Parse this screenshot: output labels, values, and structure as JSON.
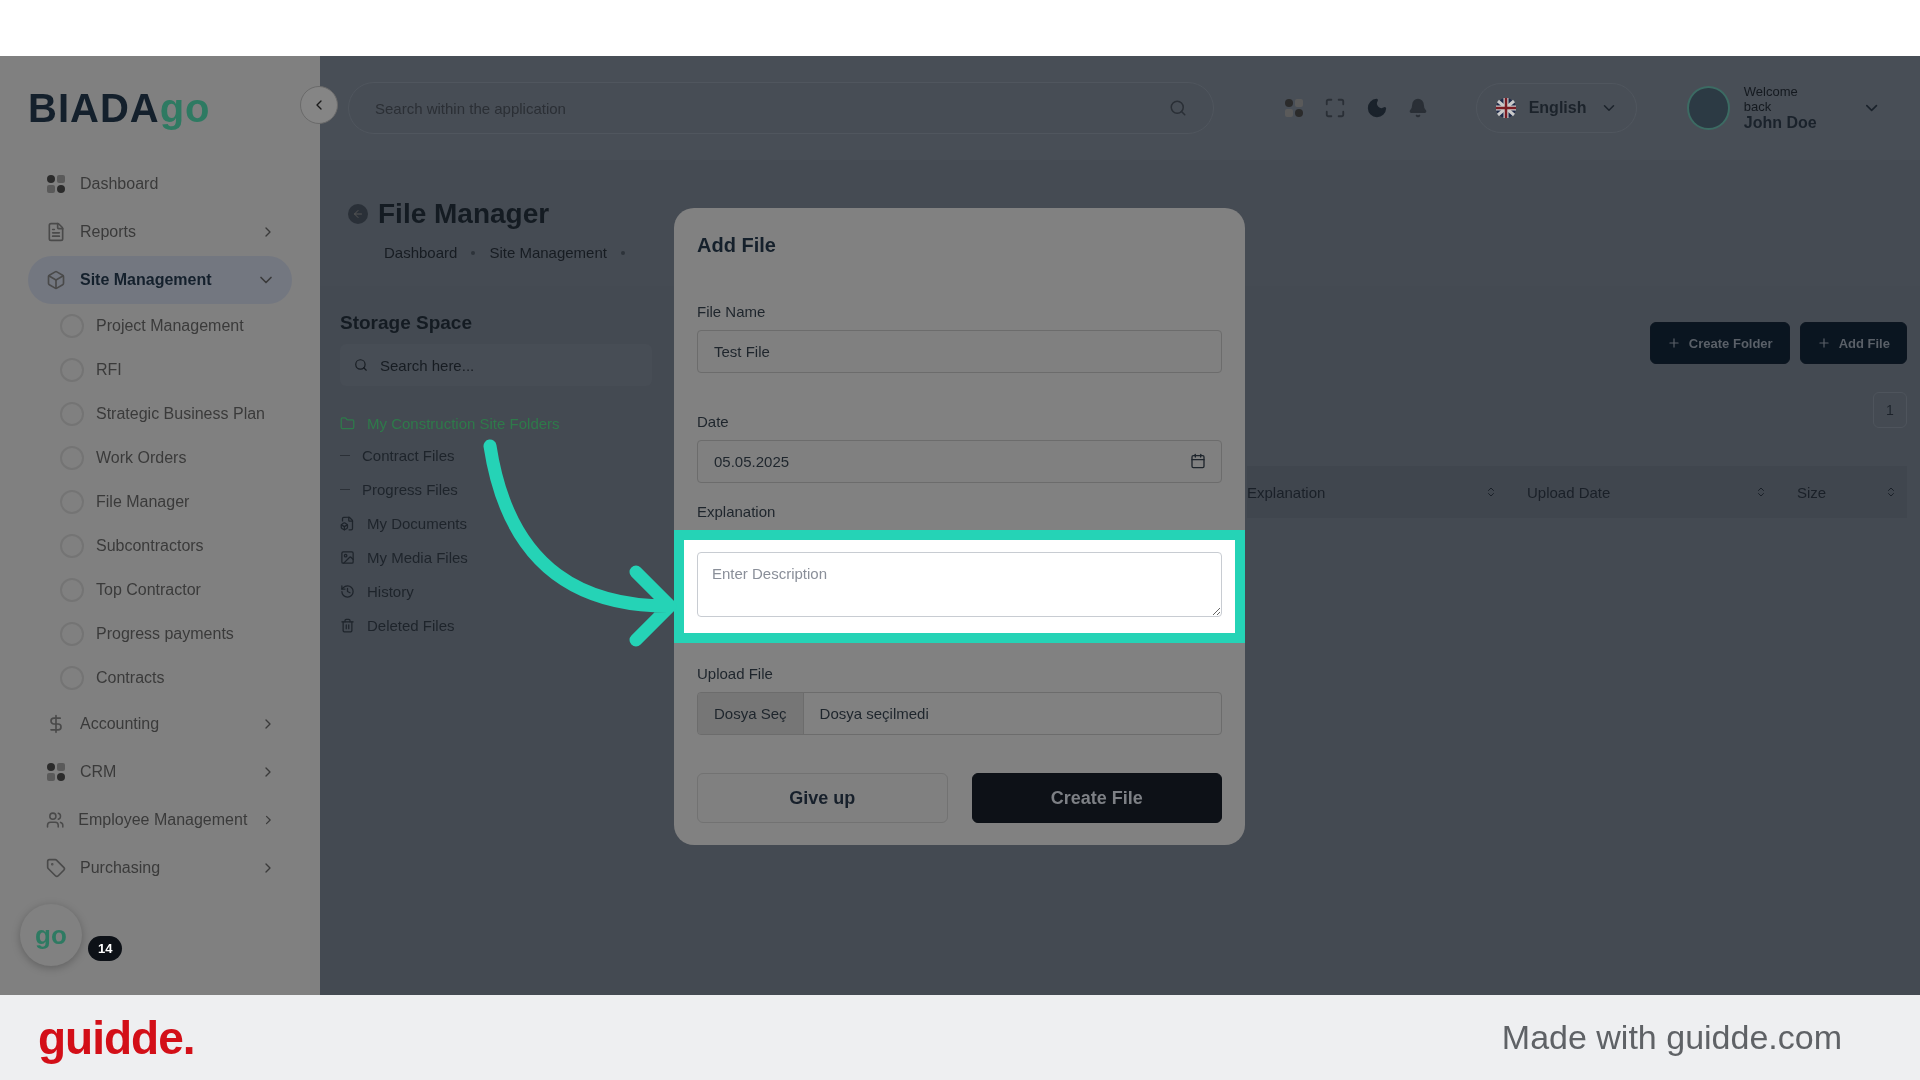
{
  "logo": {
    "text": "BIADA",
    "accent": "go"
  },
  "sidebar": {
    "items": [
      {
        "label": "Dashboard",
        "selected": false
      },
      {
        "label": "Reports",
        "selected": false,
        "expanded": false
      },
      {
        "label": "Site Management",
        "selected": true,
        "expanded": true,
        "children": [
          {
            "label": "Project Management"
          },
          {
            "label": "RFI"
          },
          {
            "label": "Strategic Business Plan"
          },
          {
            "label": "Work Orders"
          },
          {
            "label": "File Manager"
          },
          {
            "label": "Subcontractors"
          },
          {
            "label": "Top Contractor"
          },
          {
            "label": "Progress payments"
          },
          {
            "label": "Contracts"
          }
        ]
      },
      {
        "label": "Accounting",
        "selected": false,
        "expanded": false
      },
      {
        "label": "CRM",
        "selected": false,
        "expanded": false
      },
      {
        "label": "Employee Management",
        "selected": false,
        "expanded": false
      },
      {
        "label": "Purchasing",
        "selected": false,
        "expanded": false
      }
    ]
  },
  "floating_badge": {
    "logo": "go",
    "count": "14"
  },
  "header": {
    "search": {
      "placeholder": "Search within the application"
    },
    "language": "English",
    "user": {
      "greeting": "Welcome back",
      "name": "John Doe"
    }
  },
  "page": {
    "title": "File Manager",
    "breadcrumb": [
      "Dashboard",
      "Site Management"
    ]
  },
  "storage": {
    "title": "Storage Space",
    "search": {
      "placeholder": "Search here..."
    },
    "tree": [
      {
        "label": "My Construction Site Folders",
        "kind": "folder",
        "selected": true,
        "children": [
          {
            "label": "Contract Files"
          },
          {
            "label": "Progress Files"
          }
        ]
      },
      {
        "label": "My Documents",
        "kind": "documents",
        "selected": false
      },
      {
        "label": "My Media Files",
        "kind": "media",
        "selected": false
      },
      {
        "label": "History",
        "kind": "history",
        "selected": false
      },
      {
        "label": "Deleted Files",
        "kind": "trash",
        "selected": false
      }
    ]
  },
  "actions": [
    "Create Folder",
    "Add File"
  ],
  "pagination": [
    {
      "label": "1",
      "selected": false
    }
  ],
  "table": {
    "columns": [
      "Explanation",
      "Upload Date",
      "Size"
    ]
  },
  "modal": {
    "title": "Add File",
    "fields": [
      {
        "kind": "text",
        "label": "File Name",
        "value": "Test File"
      },
      {
        "kind": "date",
        "label": "Date",
        "value": "05.05.2025"
      },
      {
        "kind": "textarea",
        "label": "Explanation",
        "placeholder": "Enter Description",
        "highlighted": true
      },
      {
        "kind": "file",
        "label": "Upload File",
        "button": "Dosya Seç",
        "status": "Dosya seçilmedi"
      }
    ],
    "buttons": [
      {
        "label": "Give up",
        "kind": "secondary"
      },
      {
        "label": "Create File",
        "kind": "primary"
      }
    ]
  },
  "footer": {
    "brand": "guidde.",
    "note": "Made with guidde.com"
  }
}
